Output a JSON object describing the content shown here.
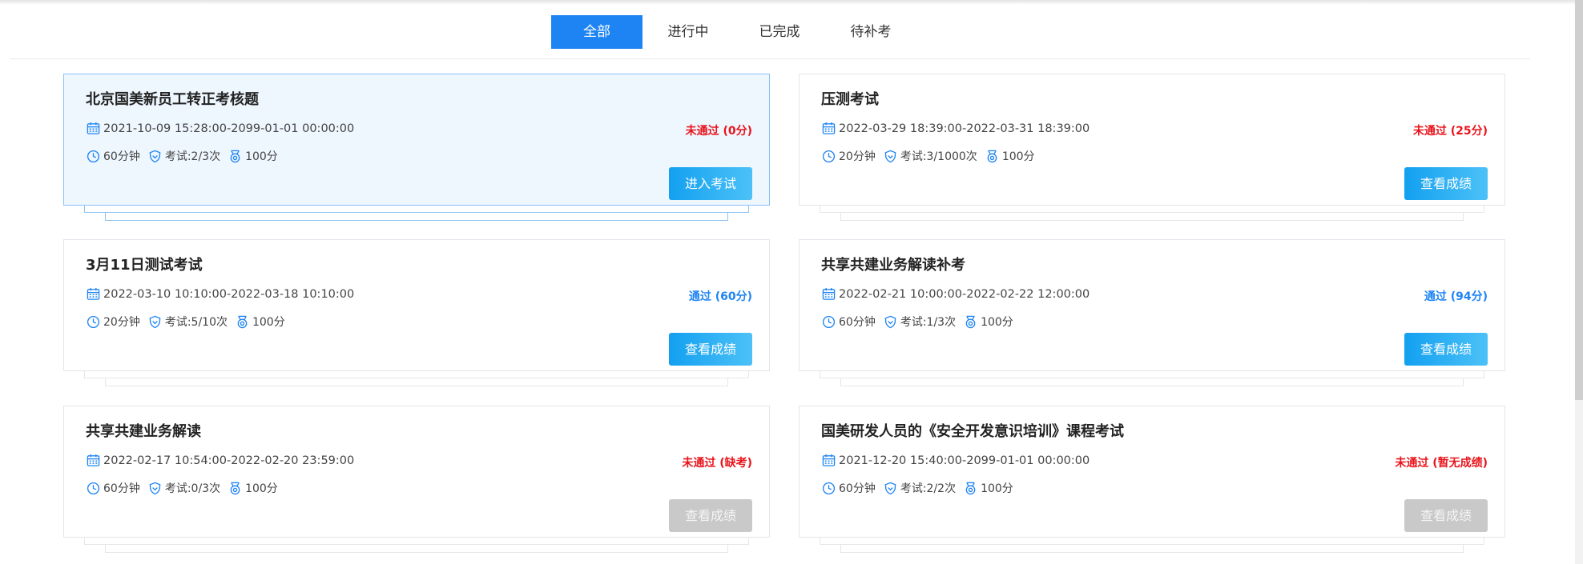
{
  "tabs": [
    {
      "label": "全部",
      "active": true
    },
    {
      "label": "进行中",
      "active": false
    },
    {
      "label": "已完成",
      "active": false
    },
    {
      "label": "待补考",
      "active": false
    }
  ],
  "colors": {
    "accent": "#1e84f4",
    "fail": "#e8141c",
    "disabled": "#c9c9c9"
  },
  "exams": [
    {
      "title": "北京国美新员工转正考核题",
      "period": "2021-10-09 15:28:00-2099-01-01 00:00:00",
      "status": "未通过 (0分)",
      "status_type": "fail",
      "duration": "60分钟",
      "attempts": "考试:2/3次",
      "full_score": "100分",
      "action": "进入考试",
      "action_enabled": true,
      "highlighted": true
    },
    {
      "title": "压测考试",
      "period": "2022-03-29 18:39:00-2022-03-31 18:39:00",
      "status": "未通过 (25分)",
      "status_type": "fail",
      "duration": "20分钟",
      "attempts": "考试:3/1000次",
      "full_score": "100分",
      "action": "查看成绩",
      "action_enabled": true,
      "highlighted": false
    },
    {
      "title": "3月11日测试考试",
      "period": "2022-03-10 10:10:00-2022-03-18 10:10:00",
      "status": "通过 (60分)",
      "status_type": "pass",
      "duration": "20分钟",
      "attempts": "考试:5/10次",
      "full_score": "100分",
      "action": "查看成绩",
      "action_enabled": true,
      "highlighted": false
    },
    {
      "title": "共享共建业务解读补考",
      "period": "2022-02-21 10:00:00-2022-02-22 12:00:00",
      "status": "通过 (94分)",
      "status_type": "pass",
      "duration": "60分钟",
      "attempts": "考试:1/3次",
      "full_score": "100分",
      "action": "查看成绩",
      "action_enabled": true,
      "highlighted": false
    },
    {
      "title": "共享共建业务解读",
      "period": "2022-02-17 10:54:00-2022-02-20 23:59:00",
      "status": "未通过 (缺考)",
      "status_type": "fail",
      "duration": "60分钟",
      "attempts": "考试:0/3次",
      "full_score": "100分",
      "action": "查看成绩",
      "action_enabled": false,
      "highlighted": false
    },
    {
      "title": "国美研发人员的《安全开发意识培训》课程考试",
      "period": "2021-12-20 15:40:00-2099-01-01 00:00:00",
      "status": "未通过 (暂无成绩)",
      "status_type": "fail",
      "duration": "60分钟",
      "attempts": "考试:2/2次",
      "full_score": "100分",
      "action": "查看成绩",
      "action_enabled": false,
      "highlighted": false
    }
  ]
}
